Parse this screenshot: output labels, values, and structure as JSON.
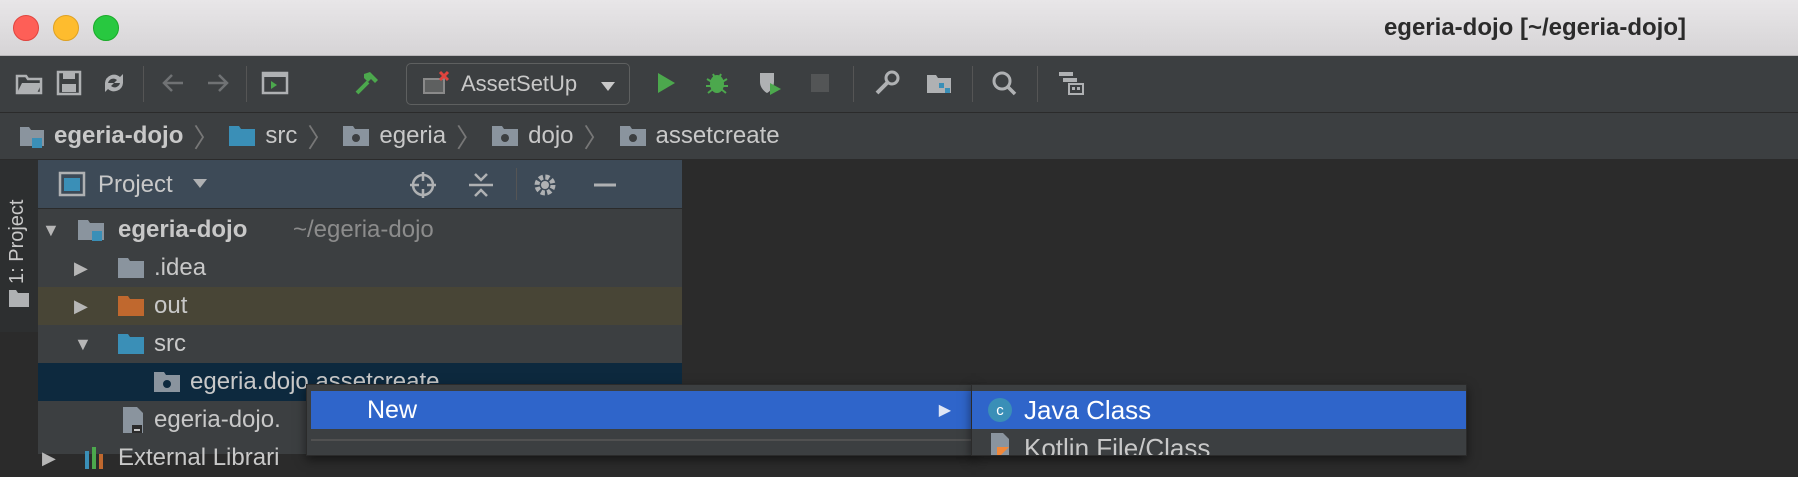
{
  "window": {
    "title": "egeria-dojo [~/egeria-dojo]"
  },
  "toolbar": {
    "run_config": "AssetSetUp"
  },
  "breadcrumbs": [
    {
      "label": "egeria-dojo"
    },
    {
      "label": "src"
    },
    {
      "label": "egeria"
    },
    {
      "label": "dojo"
    },
    {
      "label": "assetcreate"
    }
  ],
  "side_tab": {
    "label": "1: Project"
  },
  "project_panel": {
    "title": "Project",
    "tree": {
      "root_name": "egeria-dojo",
      "root_path": "~/egeria-dojo",
      "idea": ".idea",
      "out": "out",
      "src": "src",
      "package": "egeria.dojo.assetcreate",
      "iml": "egeria-dojo.",
      "external": "External Librari"
    }
  },
  "context_menu": {
    "new_label": "New",
    "submenu_arrow": "▶"
  },
  "submenu": {
    "java_class": "Java Class",
    "kotlin_file": "Kotlin File/Class"
  },
  "colors": {
    "accent": "#2f65ca",
    "folder_blue": "#3a8fb7",
    "folder_orange": "#c0682e",
    "run_green": "#4ca84d"
  }
}
